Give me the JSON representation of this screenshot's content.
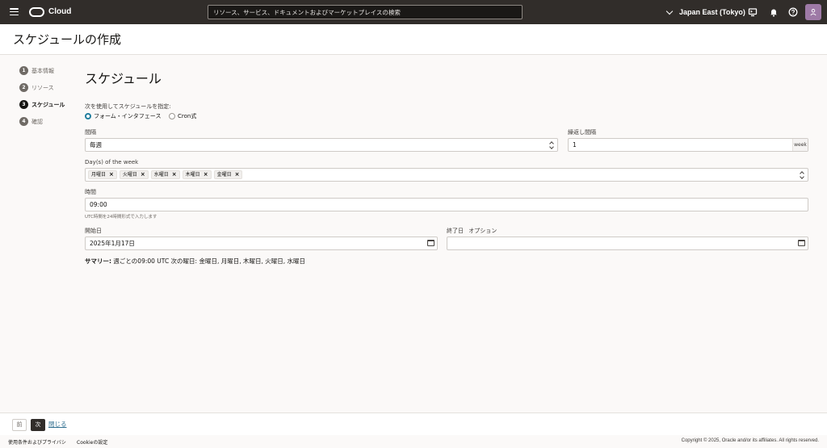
{
  "topbar": {
    "brand": "Cloud",
    "search_placeholder": "リソース、サービス、ドキュメントおよびマーケットプレイスの検索",
    "region": "Japan East (Tokyo)",
    "icons": [
      "menu-icon",
      "oracle-logo-icon",
      "chevron-down-icon",
      "cloud-shell-icon",
      "notifications-icon",
      "help-icon",
      "profile-icon"
    ]
  },
  "page": {
    "title": "スケジュールの作成"
  },
  "steps": [
    {
      "num": "1",
      "label": "基本情報",
      "active": false
    },
    {
      "num": "2",
      "label": "リソース",
      "active": false
    },
    {
      "num": "3",
      "label": "スケジュール",
      "active": true
    },
    {
      "num": "4",
      "label": "確認",
      "active": false
    }
  ],
  "form": {
    "section_title": "スケジュール",
    "specify_label": "次を使用してスケジュールを指定:",
    "radio_form": "フォーム・インタフェース",
    "radio_cron": "Cron式",
    "interval_label": "間隔",
    "interval_value": "毎週",
    "repeat_label": "繰返し間隔",
    "repeat_value": "1",
    "repeat_unit": "week",
    "days_label": "Day(s) of the week",
    "days": [
      "月曜日",
      "火曜日",
      "水曜日",
      "木曜日",
      "金曜日"
    ],
    "time_label": "時間",
    "time_value": "09:00",
    "time_help": "UTC時間を24時間形式で入力します",
    "start_label": "開始日",
    "start_value": "2025年1月17日",
    "end_label": "終了日",
    "end_optional": "オプション",
    "end_value": "",
    "summary_label": "サマリー:",
    "summary_text": " 週ごとの09:00 UTC 次の曜日: 金曜日, 月曜日, 木曜日, 火曜日, 水曜日"
  },
  "bottom": {
    "prev": "前",
    "next": "次",
    "close": "閉じる"
  },
  "footer": {
    "terms": "使用条件およびプライバシ",
    "cookie": "Cookieの設定",
    "copyright": "Copyright © 2025, Oracle and/or its affiliates. All rights reserved."
  }
}
